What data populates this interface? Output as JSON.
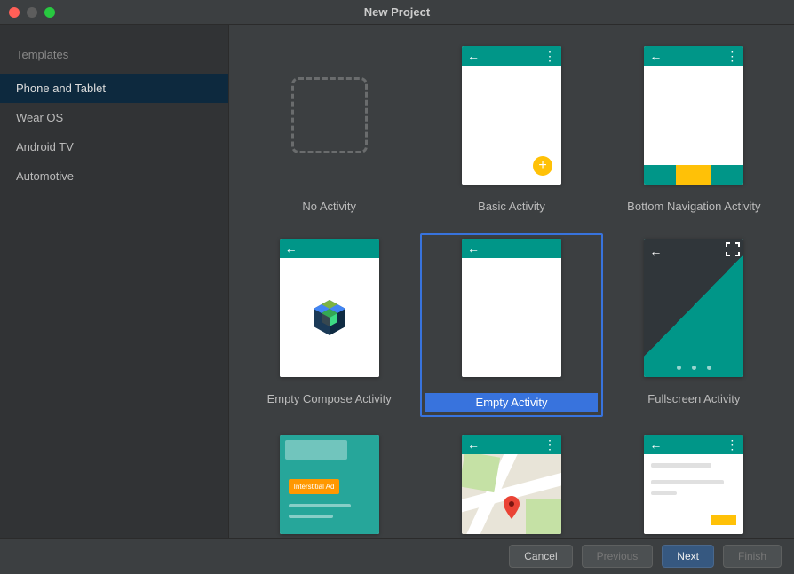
{
  "window": {
    "title": "New Project"
  },
  "sidebar": {
    "header": "Templates",
    "items": [
      {
        "label": "Phone and Tablet",
        "selected": true
      },
      {
        "label": "Wear OS",
        "selected": false
      },
      {
        "label": "Android TV",
        "selected": false
      },
      {
        "label": "Automotive",
        "selected": false
      }
    ]
  },
  "templates": [
    {
      "id": "no-activity",
      "label": "No Activity",
      "selected": false
    },
    {
      "id": "basic-activity",
      "label": "Basic Activity",
      "selected": false
    },
    {
      "id": "bottom-nav",
      "label": "Bottom Navigation Activity",
      "selected": false
    },
    {
      "id": "empty-compose",
      "label": "Empty Compose Activity",
      "selected": false
    },
    {
      "id": "empty-activity",
      "label": "Empty Activity",
      "selected": true
    },
    {
      "id": "fullscreen",
      "label": "Fullscreen Activity",
      "selected": false
    },
    {
      "id": "ad",
      "label": "",
      "pill": "Interstitial Ad",
      "selected": false
    },
    {
      "id": "maps",
      "label": "",
      "selected": false
    },
    {
      "id": "login",
      "label": "",
      "selected": false
    }
  ],
  "footer": {
    "cancel": "Cancel",
    "previous": "Previous",
    "next": "Next",
    "finish": "Finish"
  },
  "colors": {
    "teal": "#009688",
    "amber": "#ffc107",
    "orange": "#ff9800",
    "selection": "#3873dd"
  }
}
